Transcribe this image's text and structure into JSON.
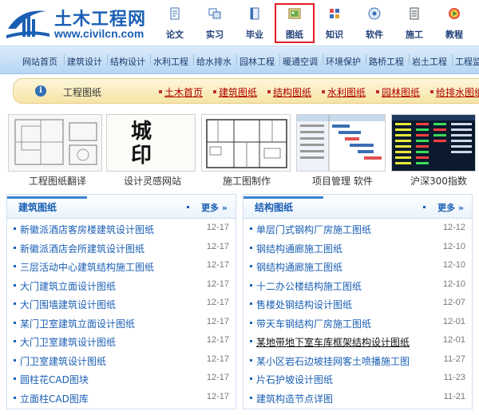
{
  "site": {
    "name": "土木工程网",
    "url": "www.civilcn.com"
  },
  "topnav": {
    "active_index": 3,
    "items": [
      {
        "label": "论文",
        "icon": "paper-icon"
      },
      {
        "label": "实习",
        "icon": "internship-icon"
      },
      {
        "label": "毕业",
        "icon": "graduation-icon"
      },
      {
        "label": "图纸",
        "icon": "drawing-icon"
      },
      {
        "label": "知识",
        "icon": "knowledge-icon"
      },
      {
        "label": "软件",
        "icon": "software-icon"
      },
      {
        "label": "施工",
        "icon": "construction-icon"
      },
      {
        "label": "教程",
        "icon": "tutorial-icon"
      }
    ]
  },
  "categories": [
    "网站首页",
    "建筑设计",
    "结构设计",
    "水利工程",
    "给水排水",
    "园林工程",
    "暖通空调",
    "环境保护",
    "路桥工程",
    "岩土工程",
    "工程监"
  ],
  "section_bar": {
    "title": "工程图纸",
    "links": [
      "土木首页",
      "建筑图纸",
      "结构图纸",
      "水利图纸",
      "园林图纸",
      "给排水图纸"
    ]
  },
  "thumbnails": [
    {
      "caption": "工程图纸翻译",
      "icon": "cad-drawing-icon"
    },
    {
      "caption": "设计灵感网站",
      "icon": "calligraphy-image-icon"
    },
    {
      "caption": "施工图制作",
      "icon": "floor-plan-icon"
    },
    {
      "caption": "项目管理 软件",
      "icon": "gantt-chart-icon"
    },
    {
      "caption": "沪深300指数",
      "icon": "stock-table-icon"
    }
  ],
  "calligraphy_text": "城 印",
  "panels": {
    "more_label": "更多 »",
    "architecture": {
      "title": "建筑图纸",
      "rows": [
        {
          "title": "新徽派酒店客房楼建筑设计图纸",
          "date": "12-17"
        },
        {
          "title": "新徽派酒店会所建筑设计图纸",
          "date": "12-17"
        },
        {
          "title": "三层活动中心建筑结构施工图纸",
          "date": "12-17"
        },
        {
          "title": "大门建筑立面设计图纸",
          "date": "12-17"
        },
        {
          "title": "大门围墙建筑设计图纸",
          "date": "12-17"
        },
        {
          "title": "某门卫室建筑立面设计图纸",
          "date": "12-17"
        },
        {
          "title": "大门卫室建筑设计图纸",
          "date": "12-17"
        },
        {
          "title": "门卫室建筑设计图纸",
          "date": "12-17"
        },
        {
          "title": "圆柱花CAD图块",
          "date": "12-17"
        },
        {
          "title": "立面柱CAD图库",
          "date": "12-17"
        }
      ]
    },
    "structure": {
      "title": "结构图纸",
      "rows": [
        {
          "title": "单层门式钢构厂房施工图纸",
          "date": "12-12"
        },
        {
          "title": "钢结构通廊施工图纸",
          "date": "12-10"
        },
        {
          "title": "钢结构通廊施工图纸",
          "date": "12-10"
        },
        {
          "title": "十二办公楼结构施工图纸",
          "date": "12-10"
        },
        {
          "title": "售楼处钢结构设计图纸",
          "date": "12-07"
        },
        {
          "title": "带天车钢结构厂房施工图纸",
          "date": "12-01"
        },
        {
          "title": "某地带地下室车库框架结构设计图纸",
          "date": "12-01"
        },
        {
          "title": "某小区岩石边坡挂网客土喷播施工图",
          "date": "11-27"
        },
        {
          "title": "片石护坡设计图纸",
          "date": "11-23"
        },
        {
          "title": "建筑构造节点详图",
          "date": "11-21"
        }
      ]
    }
  }
}
